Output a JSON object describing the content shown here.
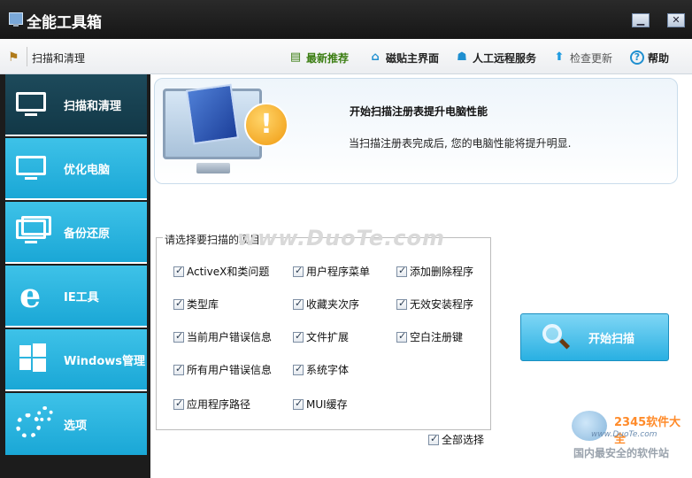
{
  "window": {
    "title": "全能工具箱",
    "minimize": "▁",
    "close": "✕"
  },
  "toolbar": {
    "breadcrumb": "扫描和清理",
    "items": [
      {
        "label": "最新推荐",
        "icon": "document-icon"
      },
      {
        "label": "磁贴主界面",
        "icon": "home-icon"
      },
      {
        "label": "人工远程服务",
        "icon": "remote-service-icon"
      },
      {
        "label": "检查更新",
        "icon": "up-arrow-icon"
      },
      {
        "label": "帮助",
        "icon": "help-icon"
      }
    ]
  },
  "sidebar": {
    "items": [
      {
        "label": "扫描和清理",
        "icon": "broom-monitor-icon",
        "active": true
      },
      {
        "label": "优化电脑",
        "icon": "wrench-monitor-icon",
        "active": false
      },
      {
        "label": "备份还原",
        "icon": "dual-monitor-icon",
        "active": false
      },
      {
        "label": "IE工具",
        "icon": "ie-icon",
        "active": false
      },
      {
        "label": "Windows管理",
        "icon": "windows-icon",
        "active": false
      },
      {
        "label": "选项",
        "icon": "gears-icon",
        "active": false
      }
    ]
  },
  "banner": {
    "title": "开始扫描注册表提升电脑性能",
    "description": "当扫描注册表完成后, 您的电脑性能将提升明显."
  },
  "scan_group": {
    "title": "请选择要扫描的项目",
    "items": [
      {
        "label": "ActiveX和类问题",
        "checked": true
      },
      {
        "label": "用户程序菜单",
        "checked": true
      },
      {
        "label": "添加删除程序",
        "checked": true
      },
      {
        "label": "类型库",
        "checked": true
      },
      {
        "label": "收藏夹次序",
        "checked": true
      },
      {
        "label": "无效安装程序",
        "checked": true
      },
      {
        "label": "当前用户错误信息",
        "checked": true
      },
      {
        "label": "文件扩展",
        "checked": true
      },
      {
        "label": "空白注册键",
        "checked": true
      },
      {
        "label": "所有用户错误信息",
        "checked": true
      },
      {
        "label": "系统字体",
        "checked": true
      },
      {
        "label": "应用程序路径",
        "checked": true
      },
      {
        "label": "MUI缓存",
        "checked": true
      }
    ],
    "select_all": {
      "label": "全部选择",
      "checked": true
    }
  },
  "scan_button": {
    "label": "开始扫描"
  },
  "watermark": "www.DuoTe.com",
  "brand": {
    "logo": "2345软件大全",
    "site": "www.DuoTe.com",
    "slogan": "国内最安全的软件站"
  },
  "colors": {
    "sidebar": "#1aa7d6",
    "sidebar_active": "#123847",
    "accent_green": "#3b7d12",
    "scan_button": "#29b0e2"
  }
}
